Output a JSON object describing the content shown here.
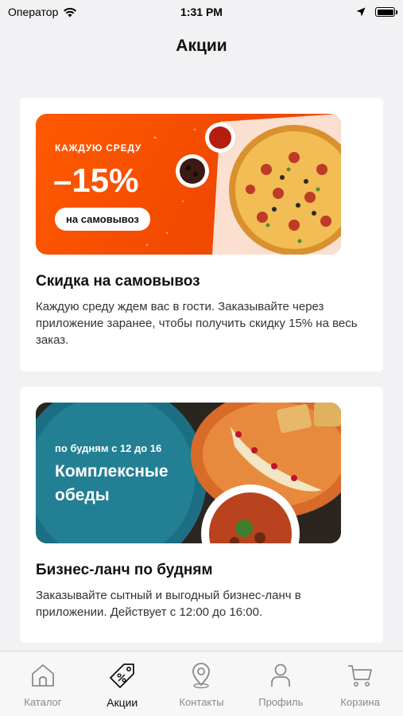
{
  "status_bar": {
    "carrier": "Оператор",
    "time": "1:31 PM"
  },
  "header": {
    "title": "Акции"
  },
  "promos": [
    {
      "banner": {
        "line1": "КАЖДУЮ СРЕДУ",
        "big": "–15%",
        "pill": "на самовывоз"
      },
      "title": "Скидка на самовывоз",
      "description": "Каждую среду ждем вас в гости. Заказывайте через приложение заранее, чтобы получить скидку 15% на весь заказ."
    },
    {
      "banner": {
        "line1": "по будням с 12 до 16",
        "big": "Комплексные обеды"
      },
      "title": "Бизнес-ланч по будням",
      "description": "Заказывайте сытный и выгодный бизнес-ланч в приложении. Действует с 12:00 до 16:00."
    }
  ],
  "tabbar": {
    "active": "Акции",
    "items": [
      {
        "label": "Каталог",
        "icon": "home-icon"
      },
      {
        "label": "Акции",
        "icon": "tag-icon"
      },
      {
        "label": "Контакты",
        "icon": "location-pin-icon"
      },
      {
        "label": "Профиль",
        "icon": "person-icon"
      },
      {
        "label": "Корзина",
        "icon": "cart-icon"
      }
    ]
  },
  "colors": {
    "accent_orange": "#f24a00",
    "banner_teal": "#1f7d92",
    "background": "#f2f2f4"
  }
}
